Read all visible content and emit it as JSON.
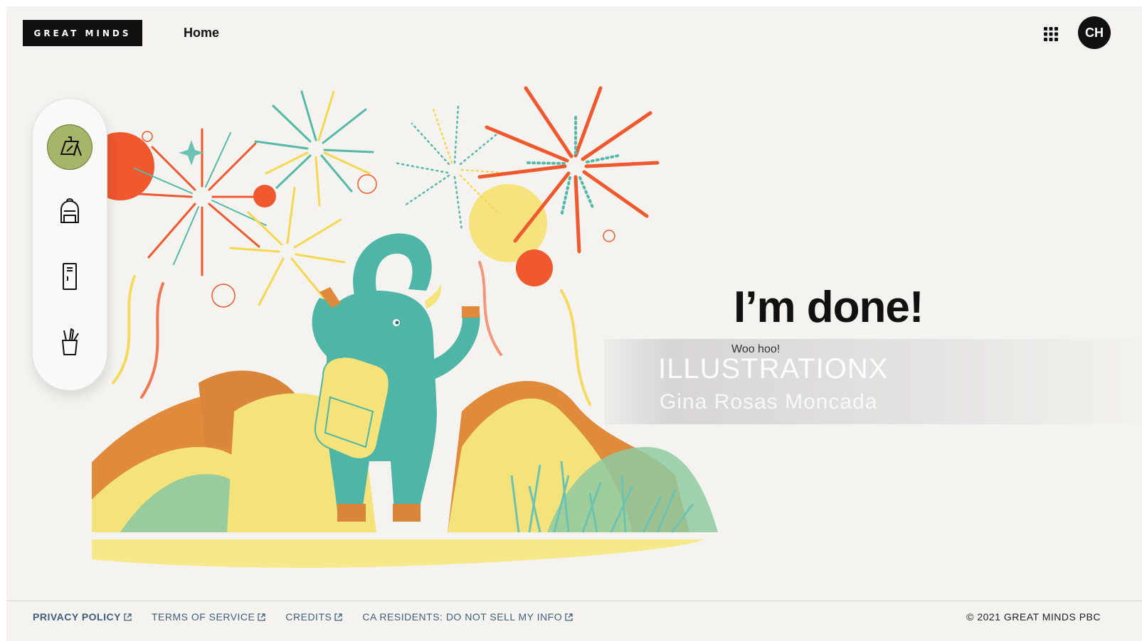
{
  "header": {
    "logo_text": "GREAT MINDS",
    "nav_home": "Home",
    "apps_icon": "grid-icon",
    "avatar_initials": "CH"
  },
  "dock": {
    "items": [
      {
        "icon": "drawing-easel-icon",
        "active": true
      },
      {
        "icon": "backpack-icon",
        "active": false
      },
      {
        "icon": "locker-icon",
        "active": false
      },
      {
        "icon": "pencil-cup-icon",
        "active": false
      }
    ]
  },
  "main": {
    "title": "I’m done!",
    "subtitle": "Woo hoo!"
  },
  "watermark": {
    "brand": "ILLUSTRATIONX",
    "artist": "Gina Rosas Moncada"
  },
  "footer": {
    "links": [
      {
        "label": "PRIVACY POLICY"
      },
      {
        "label": "TERMS OF SERVICE"
      },
      {
        "label": "CREDITS"
      },
      {
        "label": "CA RESIDENTS: DO NOT SELL MY INFO"
      }
    ],
    "external_icon": "external-link-icon",
    "copyright": "© 2021 GREAT MINDS PBC"
  },
  "colors": {
    "background": "#f4f3ef",
    "accent_green": "#a5b56a",
    "elephant_teal": "#4fb5a6",
    "firework_orange": "#f0582e",
    "sun_yellow": "#f7e170",
    "footer_link": "#3f5e7c"
  }
}
